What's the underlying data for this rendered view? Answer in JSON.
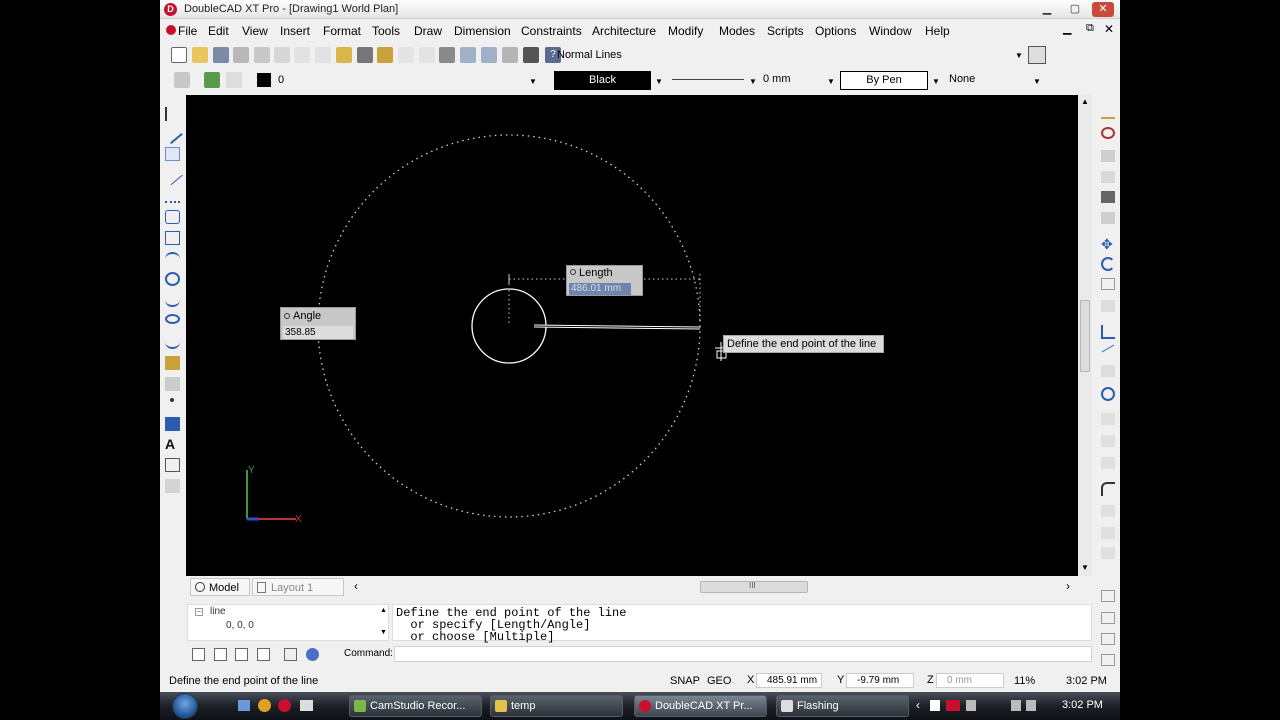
{
  "window": {
    "title": "DoubleCAD XT Pro - [Drawing1 World Plan]",
    "app_icon": "doublecad-icon",
    "controls": {
      "minimize": "▁",
      "maximize": "▢",
      "close": "✕"
    },
    "mdi_controls": {
      "minimize": "▁",
      "restore": "⧉",
      "close": "✕"
    }
  },
  "menu": [
    "File",
    "Edit",
    "View",
    "Insert",
    "Format",
    "Tools",
    "Draw",
    "Dimension",
    "Constraints",
    "Architecture",
    "Modify",
    "Modes",
    "Scripts",
    "Options",
    "Window",
    "Help"
  ],
  "toolbar1": {
    "line_style": "Normal Lines"
  },
  "toolbar2": {
    "layer": "0",
    "color": "Black",
    "line_width": "0 mm",
    "pen": "By Pen",
    "fill": "None"
  },
  "canvas": {
    "length_label": "Length",
    "length_value": "486.01 mm",
    "angle_label": "Angle",
    "angle_value": "358.85",
    "tooltip": "Define the end point of the line",
    "axis_x": "X",
    "axis_y": "Y"
  },
  "tabs": {
    "model": "Model",
    "layout": "Layout 1",
    "scroll_left": "‹",
    "scroll_right": "›",
    "thumb_grip": "III"
  },
  "command": {
    "tree_root": "line",
    "tree_child": "0, 0, 0",
    "history": "Define the end point of the line\n  or specify [Length/Angle]\n  or choose [Multiple]",
    "prompt_label": "Command:"
  },
  "status": {
    "message": "Define the end point of the line",
    "snap": "SNAP",
    "geo": "GEO",
    "x": "485.91 mm",
    "y": "-9.79 mm",
    "z": "0 mm",
    "zoom": "11%",
    "time": "3:02 PM"
  },
  "taskbar": {
    "items": [
      "CamStudio Recor...",
      "temp",
      "DoubleCAD XT Pr...",
      "Flashing"
    ],
    "clock": "3:02 PM"
  }
}
